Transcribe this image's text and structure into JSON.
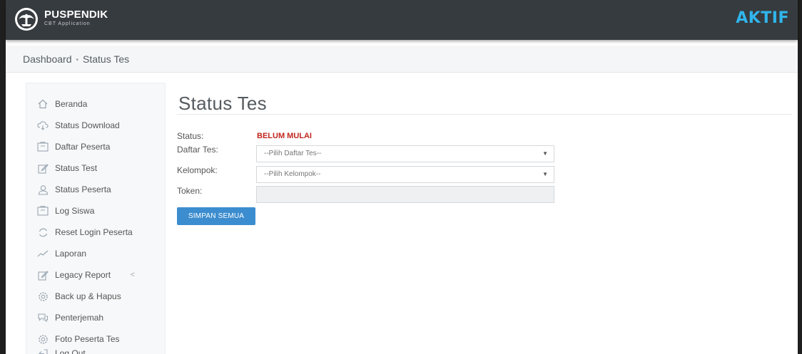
{
  "header": {
    "brand_name": "PUSPENDIK",
    "brand_subtitle": "CBT Application",
    "status": "AKTIF",
    "status_color": "#30b5ec",
    "logo_icon": "tut-wuri-emblem"
  },
  "breadcrumb": {
    "root": "Dashboard",
    "separator": "•",
    "current": "Status Tes"
  },
  "sidebar": {
    "items": [
      {
        "label": "Beranda",
        "icon": "home-icon"
      },
      {
        "label": "Status Download",
        "icon": "cloud-download-icon"
      },
      {
        "label": "Daftar Peserta",
        "icon": "document-icon"
      },
      {
        "label": "Status Test",
        "icon": "edit-icon"
      },
      {
        "label": "Status Peserta",
        "icon": "user-icon"
      },
      {
        "label": "Log Siswa",
        "icon": "document-icon"
      },
      {
        "label": "Reset Login Peserta",
        "icon": "refresh-icon"
      },
      {
        "label": "Laporan",
        "icon": "chart-line-icon"
      },
      {
        "label": "Legacy Report",
        "icon": "edit-icon",
        "chevron": "<"
      },
      {
        "label": "Back up & Hapus",
        "icon": "gear-icon"
      },
      {
        "label": "Penterjemah",
        "icon": "chat-icon"
      },
      {
        "label": "Foto Peserta Tes",
        "icon": "gear-icon"
      },
      {
        "label": "Log Out",
        "icon": "logout-icon"
      }
    ]
  },
  "main": {
    "title": "Status Tes",
    "form": {
      "status_label": "Status:",
      "status_value": "BELUM MULAI",
      "status_value_color": "#c0261f",
      "daftar_label": "Daftar Tes:",
      "daftar_selected": "--Pilih Daftar Tes--",
      "kelompok_label": "Kelompok:",
      "kelompok_selected": "--Pilih Kelompok--",
      "token_label": "Token:",
      "token_value": "",
      "save_label": "SIMPAN SEMUA"
    }
  }
}
